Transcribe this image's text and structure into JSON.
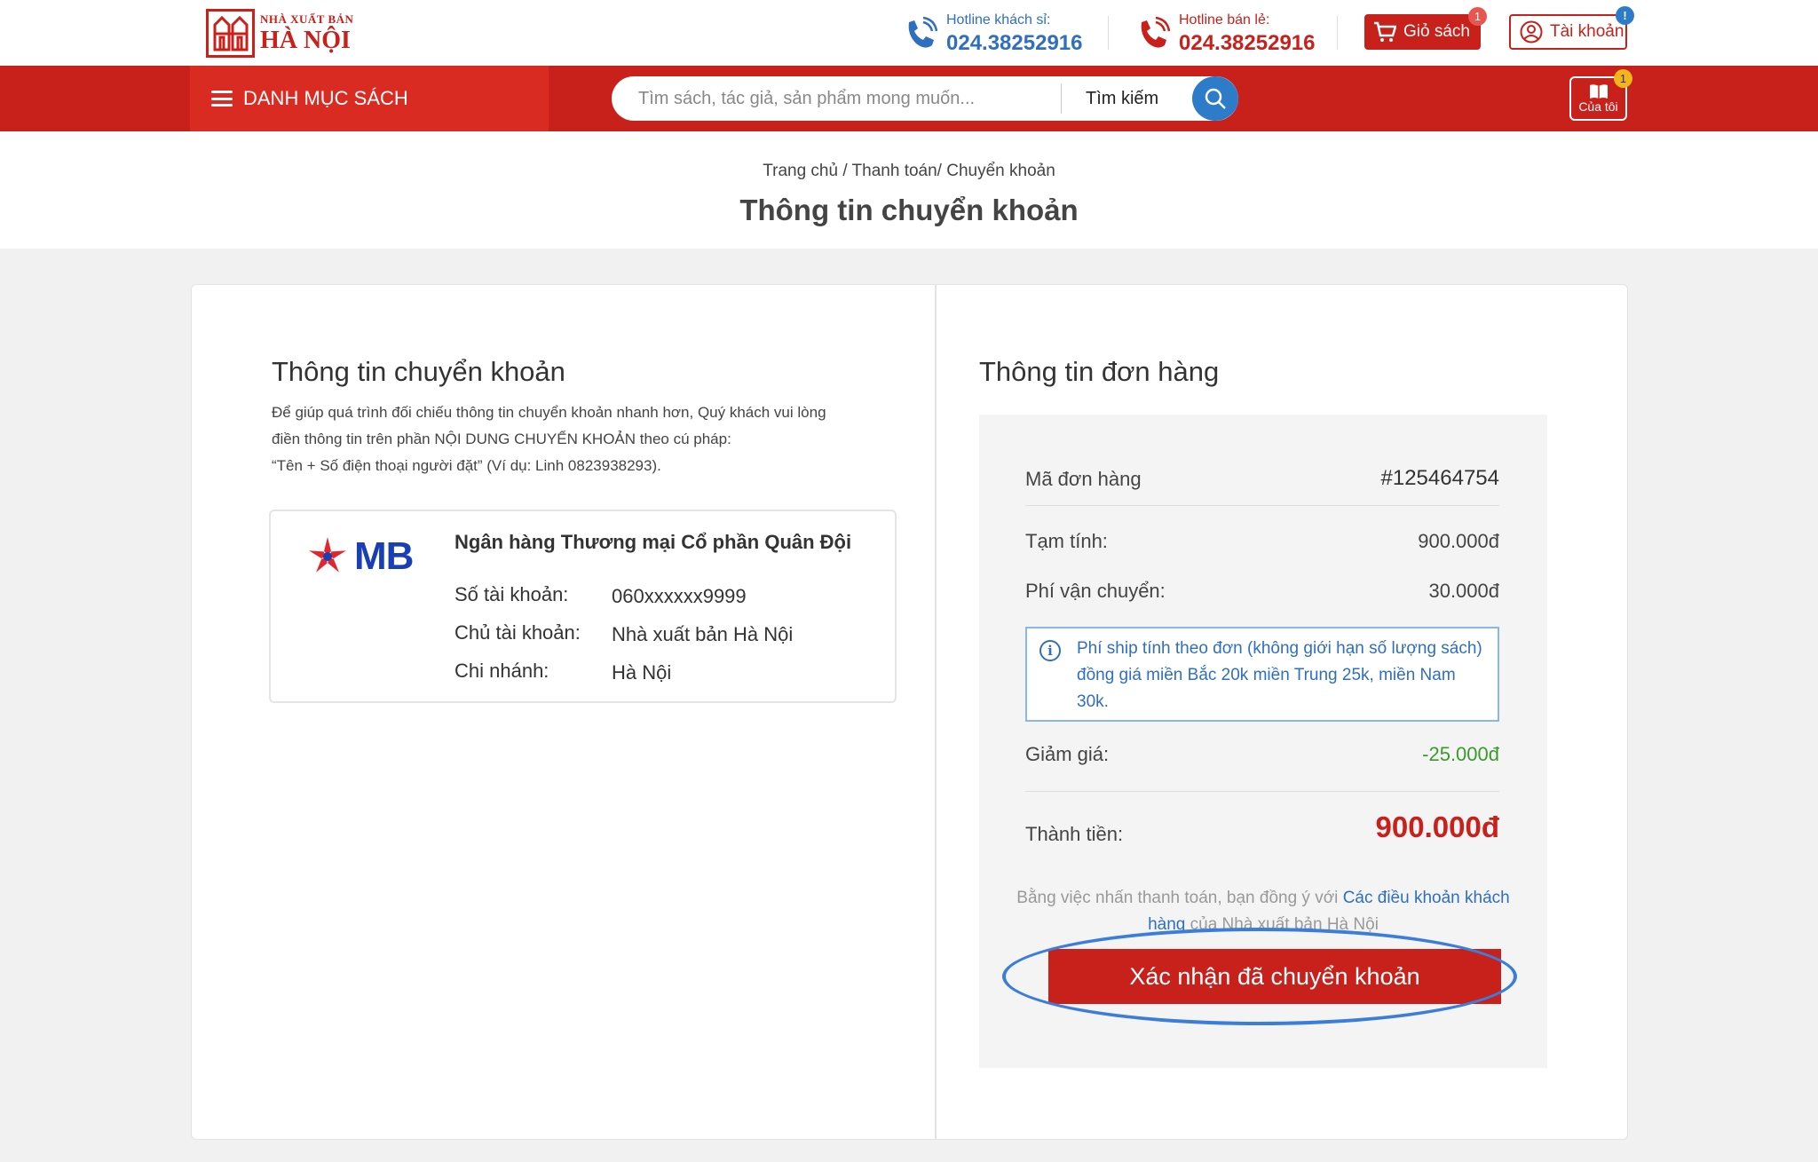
{
  "header": {
    "logo_small": "NHÀ XUẤT BẢN",
    "logo_big": "HÀ NỘI",
    "hotline_wholesale_label": "Hotline khách sỉ:",
    "hotline_wholesale_number": "024.38252916",
    "hotline_retail_label": "Hotline bán lẻ:",
    "hotline_retail_number": "024.38252916",
    "cart_label": "Giỏ sách",
    "cart_badge": "1",
    "account_label": "Tài khoản",
    "account_badge": "!"
  },
  "nav": {
    "category_label": "DANH MỤC SÁCH",
    "search_placeholder": "Tìm sách, tác giả, sản phẩm mong muốn...",
    "search_label": "Tìm kiếm",
    "mine_label": "Của tôi",
    "mine_badge": "1"
  },
  "page": {
    "breadcrumb": "Trang chủ / Thanh toán/ Chuyển khoản",
    "title": "Thông tin chuyển khoản"
  },
  "transfer": {
    "heading": "Thông tin chuyển khoản",
    "note_line1": "Để giúp quá trình đối chiếu thông tin chuyển khoản nhanh hơn, Quý khách vui lòng",
    "note_line2": "điền thông tin trên phần NỘI DUNG CHUYỂN KHOẢN theo cú pháp:",
    "note_line3": " “Tên + Số điện thoại người đặt” (Ví dụ: Linh 0823938293).",
    "bank_logo_text": "MB",
    "bank_name": "Ngân hàng Thương mại Cổ phần Quân Đội",
    "account_no_label": "Số tài khoản:",
    "account_no": "060xxxxxx9999",
    "owner_label": "Chủ tài khoản:",
    "owner": "Nhà xuất bản Hà Nội",
    "branch_label": "Chi nhánh:",
    "branch": "Hà Nội"
  },
  "order": {
    "heading": "Thông tin đơn hàng",
    "code_label": "Mã đơn hàng",
    "code": "#125464754",
    "subtotal_label": "Tạm tính:",
    "subtotal": "900.000đ",
    "shipping_label": "Phí vận chuyển:",
    "shipping": "30.000đ",
    "shipping_note": "Phí ship tính theo đơn (không giới hạn số lượng sách) đồng giá miền Bắc 20k miền Trung 25k, miền Nam 30k.",
    "discount_label": "Giảm giá:",
    "discount": "-25.000đ",
    "total_label": "Thành tiền:",
    "total": "900.000đ",
    "terms_prefix": "Bằng việc nhấn thanh toán, bạn đồng ý với ",
    "terms_link": "Các điều khoản khách hàng",
    "terms_suffix": " của Nhà xuất bản Hà Nội",
    "confirm_label": "Xác nhận đã chuyển khoản"
  },
  "colors": {
    "brand_red": "#c8201b",
    "accent_blue": "#2f6fbe",
    "discount_green": "#3a9a2d"
  }
}
